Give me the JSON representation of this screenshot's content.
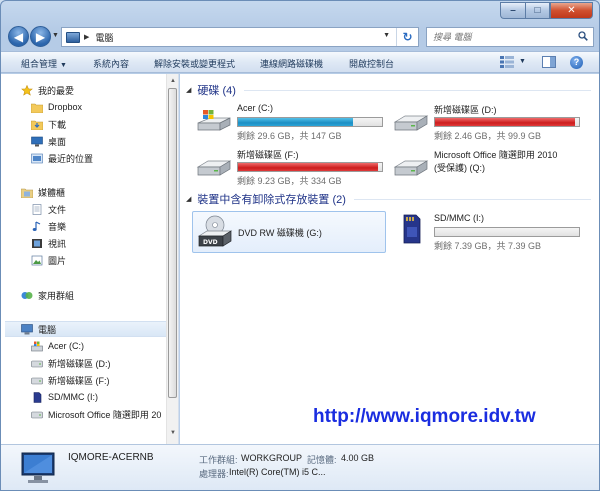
{
  "address": {
    "path": "電腦",
    "search_placeholder": "搜尋 電腦"
  },
  "toolbar": {
    "organize": "組合管理",
    "system_properties": "系統內容",
    "uninstall": "解除安裝或變更程式",
    "map_drive": "連線網路磁碟機",
    "control_panel": "開啟控制台"
  },
  "nav": {
    "favorites": "我的最愛",
    "dropbox": "Dropbox",
    "downloads": "下載",
    "desktop": "桌面",
    "recent": "最近的位置",
    "libraries": "媒體櫃",
    "documents": "文件",
    "music": "音樂",
    "videos": "視訊",
    "pictures": "圖片",
    "homegroup": "家用群組",
    "computer": "電腦",
    "drive_c": "Acer (C:)",
    "drive_d": "新增磁碟區 (D:)",
    "drive_f": "新增磁碟區 (F:)",
    "drive_i": "SD/MMC (I:)",
    "drive_q": "Microsoft Office 隨選即用 20"
  },
  "groups": {
    "hdd": "硬碟 (4)",
    "removable": "裝置中含有卸除式存放裝置 (2)"
  },
  "drives": {
    "c": {
      "name": "Acer (C:)",
      "info": "剩餘 29.6 GB，共 147 GB",
      "used_fraction": 0.8
    },
    "d": {
      "name": "新增磁碟區 (D:)",
      "info": "剩餘 2.46 GB，共 99.9 GB",
      "used_fraction": 0.975
    },
    "f": {
      "name": "新增磁碟區 (F:)",
      "info": "剩餘 9.23 GB，共 334 GB",
      "used_fraction": 0.972
    },
    "q": {
      "name": "Microsoft Office 隨選即用 2010",
      "name2": "(受保護) (Q:)"
    },
    "g": {
      "name": "DVD RW 磁碟機 (G:)"
    },
    "i": {
      "name": "SD/MMC (I:)",
      "info": "剩餘 7.39 GB，共 7.39 GB",
      "used_fraction": 0.0
    }
  },
  "watermark": "http://www.iqmore.idv.tw",
  "details": {
    "name": "IQMORE-ACERNB",
    "workgroup_label": "工作群組:",
    "workgroup": "WORKGROUP",
    "memory_label": "記憶體:",
    "memory": "4.00 GB",
    "cpu_label": "處理器:",
    "cpu": "Intel(R) Core(TM) i5 C..."
  },
  "colors": {
    "bar_normal": "#1c8fc4",
    "bar_full": "#cc1d1d",
    "group_header": "#1e3287",
    "watermark": "#1a2de0"
  }
}
